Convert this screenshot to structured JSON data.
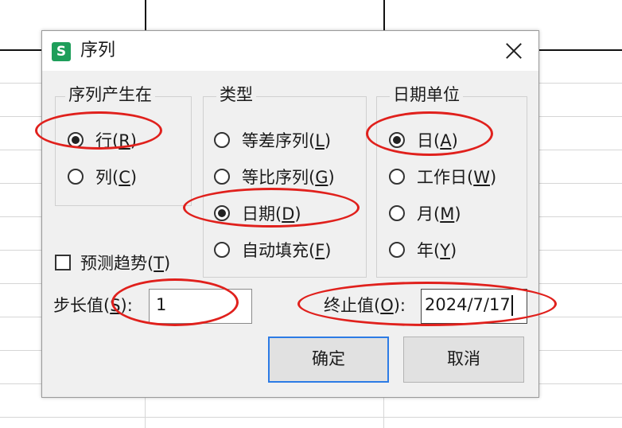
{
  "dialog": {
    "title": "序列",
    "app_icon_letter": "S",
    "direction": {
      "legend": "序列产生在",
      "options": [
        {
          "text": "行(",
          "key": "R",
          "end": ")",
          "selected": true
        },
        {
          "text": "列(",
          "key": "C",
          "end": ")",
          "selected": false
        }
      ]
    },
    "type": {
      "legend": "类型",
      "options": [
        {
          "text": "等差序列(",
          "key": "L",
          "end": ")",
          "selected": false
        },
        {
          "text": "等比序列(",
          "key": "G",
          "end": ")",
          "selected": false
        },
        {
          "text": "日期(",
          "key": "D",
          "end": ")",
          "selected": true
        },
        {
          "text": "自动填充(",
          "key": "F",
          "end": ")",
          "selected": false
        }
      ]
    },
    "date_unit": {
      "legend": "日期单位",
      "options": [
        {
          "text": "日(",
          "key": "A",
          "end": ")",
          "selected": true
        },
        {
          "text": "工作日(",
          "key": "W",
          "end": ")",
          "selected": false
        },
        {
          "text": "月(",
          "key": "M",
          "end": ")",
          "selected": false
        },
        {
          "text": "年(",
          "key": "Y",
          "end": ")",
          "selected": false
        }
      ]
    },
    "trend": {
      "text": "预测趋势(",
      "key": "T",
      "end": ")",
      "checked": false
    },
    "step": {
      "label": "步长值(",
      "key": "S",
      "end": "):",
      "value": "1"
    },
    "stop": {
      "label": "终止值(",
      "key": "O",
      "end": "):",
      "value": "2024/7/17"
    },
    "buttons": {
      "ok": "确定",
      "cancel": "取消"
    }
  },
  "annotation_color": "#e0201c",
  "accent_color": "#2c7be5",
  "icon_color": "#1e9e5a"
}
